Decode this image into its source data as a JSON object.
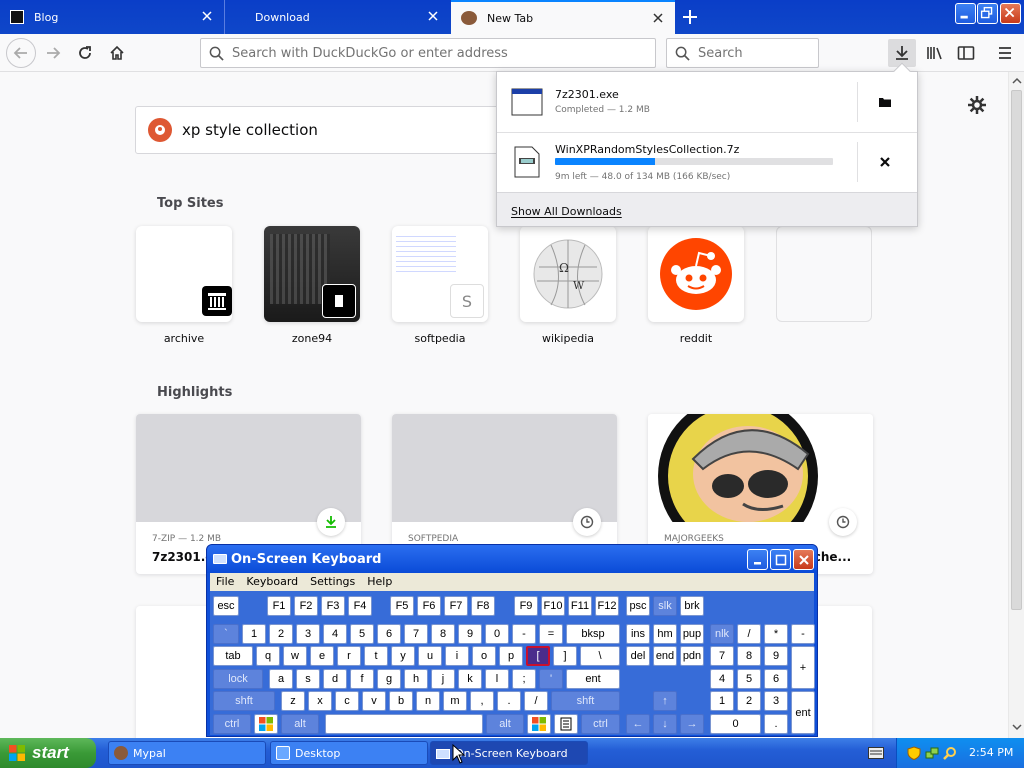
{
  "browser": {
    "tabs": [
      {
        "title": "Blog",
        "active": false
      },
      {
        "title": "Download",
        "active": false
      },
      {
        "title": "New Tab",
        "active": true
      }
    ],
    "url_placeholder": "Search with DuckDuckGo or enter address",
    "search_placeholder": "Search"
  },
  "newtab": {
    "search_query": "xp style collection",
    "top_sites_title": "Top Sites",
    "top_sites": [
      {
        "label": "archive"
      },
      {
        "label": "zone94"
      },
      {
        "label": "softpedia"
      },
      {
        "label": "wikipedia"
      },
      {
        "label": "reddit"
      },
      {
        "label": ""
      }
    ],
    "highlights_title": "Highlights",
    "highlights": [
      {
        "context": "7-ZIP — 1.2 MB",
        "title": "7z2301.ex"
      },
      {
        "context": "SOFTPEDIA",
        "title": ""
      },
      {
        "context": "MAJORGEEKS",
        "title": "tche..."
      }
    ]
  },
  "downloads": {
    "items": [
      {
        "name": "7z2301.exe",
        "status": "Completed — 1.2 MB"
      },
      {
        "name": "WinXPRandomStylesCollection.7z",
        "status": "9m left — 48.0 of 134 MB (166 KB/sec)",
        "progress": 0.36
      }
    ],
    "show_all": "Show All Downloads"
  },
  "osk": {
    "title": "On-Screen Keyboard",
    "menu": [
      "File",
      "Keyboard",
      "Settings",
      "Help"
    ],
    "keys": {
      "esc": "esc",
      "f1": "F1",
      "f2": "F2",
      "f3": "F3",
      "f4": "F4",
      "f5": "F5",
      "f6": "F6",
      "f7": "F7",
      "f8": "F8",
      "f9": "F9",
      "f10": "F10",
      "f11": "F11",
      "f12": "F12",
      "psc": "psc",
      "slk": "slk",
      "brk": "brk",
      "grave": "`",
      "n1": "1",
      "n2": "2",
      "n3": "3",
      "n4": "4",
      "n5": "5",
      "n6": "6",
      "n7": "7",
      "n8": "8",
      "n9": "9",
      "n0": "0",
      "minus": "-",
      "equals": "=",
      "bksp": "bksp",
      "ins": "ins",
      "hm": "hm",
      "pup": "pup",
      "nlk": "nlk",
      "kslash": "/",
      "kstar": "*",
      "kminus": "-",
      "tab": "tab",
      "q": "q",
      "w": "w",
      "e": "e",
      "r": "r",
      "t": "t",
      "y": "y",
      "u": "u",
      "i": "i",
      "o": "o",
      "p": "p",
      "lbracket": "[",
      "rbracket": "]",
      "bslash": "\\",
      "del": "del",
      "end": "end",
      "pdn": "pdn",
      "k7": "7",
      "k8": "8",
      "k9": "9",
      "kplus": "+",
      "lock": "lock",
      "a": "a",
      "s": "s",
      "d": "d",
      "f": "f",
      "g": "g",
      "h": "h",
      "j": "j",
      "k": "k",
      "l": "l",
      "semi": ";",
      "quote": "'",
      "ent": "ent",
      "k4": "4",
      "k5": "5",
      "k6": "6",
      "shft": "shft",
      "z": "z",
      "x": "x",
      "c": "c",
      "v": "v",
      "b": "b",
      "n": "n",
      "m": "m",
      "comma": ",",
      "period": ".",
      "slash": "/",
      "rshft": "shft",
      "up": "↑",
      "k1": "1",
      "k2": "2",
      "k3": "3",
      "kent": "ent",
      "ctrl": "ctrl",
      "alt": "alt",
      "ralt": "alt",
      "rctrl": "ctrl",
      "left": "←",
      "down": "↓",
      "right": "→",
      "k0": "0",
      "kdot": "."
    }
  },
  "taskbar": {
    "start": "start",
    "tasks": [
      {
        "label": "Mypal"
      },
      {
        "label": "Desktop"
      },
      {
        "label": "On-Screen Keyboard",
        "active": true
      }
    ],
    "clock": "2:54 PM"
  },
  "colors": {
    "accent": "#0a84ff",
    "xp_blue": "#245ed6",
    "start_green": "#3a9a37"
  }
}
